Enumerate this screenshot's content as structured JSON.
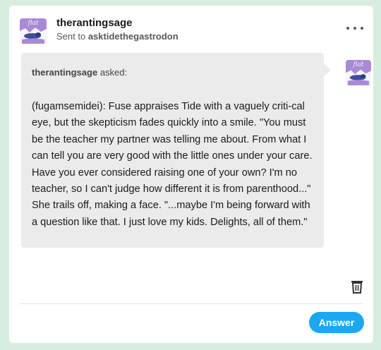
{
  "post": {
    "author": "therantingsage",
    "sent_to_prefix": "Sent to",
    "recipient": "asktidethegastrodon",
    "avatar_text": "flat"
  },
  "ask": {
    "asker": "therantingsage",
    "asked_label": "asked:",
    "avatar_text": "flat",
    "body": "(fugamsemidei): Fuse appraises Tide with a vaguely criti-cal eye, but the skepticism fades quickly into a smile. \"You must be the teacher my partner was telling me about. From what I can tell you are very good with the little ones under your care. Have you ever considered raising one of your own? I'm no teacher, so I can't judge how different it is from parenthood...\" She trails off, making a face. \"...maybe I'm being forward with a question like that. I just love my kids. Delights, all of them.\""
  },
  "actions": {
    "answer_label": "Answer"
  },
  "icons": {
    "more": "more-dots-icon",
    "delete": "trash-icon"
  },
  "colors": {
    "background": "#d6ede0",
    "avatar": "#a98ad6",
    "answer_button": "#1ba8f0",
    "bubble": "#ebebeb"
  }
}
